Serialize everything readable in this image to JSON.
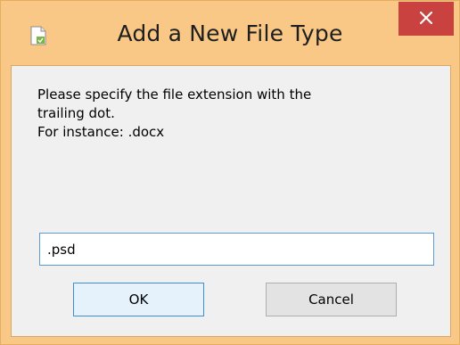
{
  "window": {
    "title": "Add a New File Type",
    "icon": "document-icon",
    "close_symbol": "✕"
  },
  "dialog": {
    "message_lines": [
      "Please specify the file extension with the",
      "trailing dot.",
      "For instance: .docx"
    ],
    "input_value": ".psd",
    "ok_label": "OK",
    "cancel_label": "Cancel"
  },
  "colors": {
    "frame": "#f9c886",
    "close_button": "#c9423f",
    "input_focus_border": "#5b9bd5",
    "default_button_border": "#3c8fd6"
  }
}
